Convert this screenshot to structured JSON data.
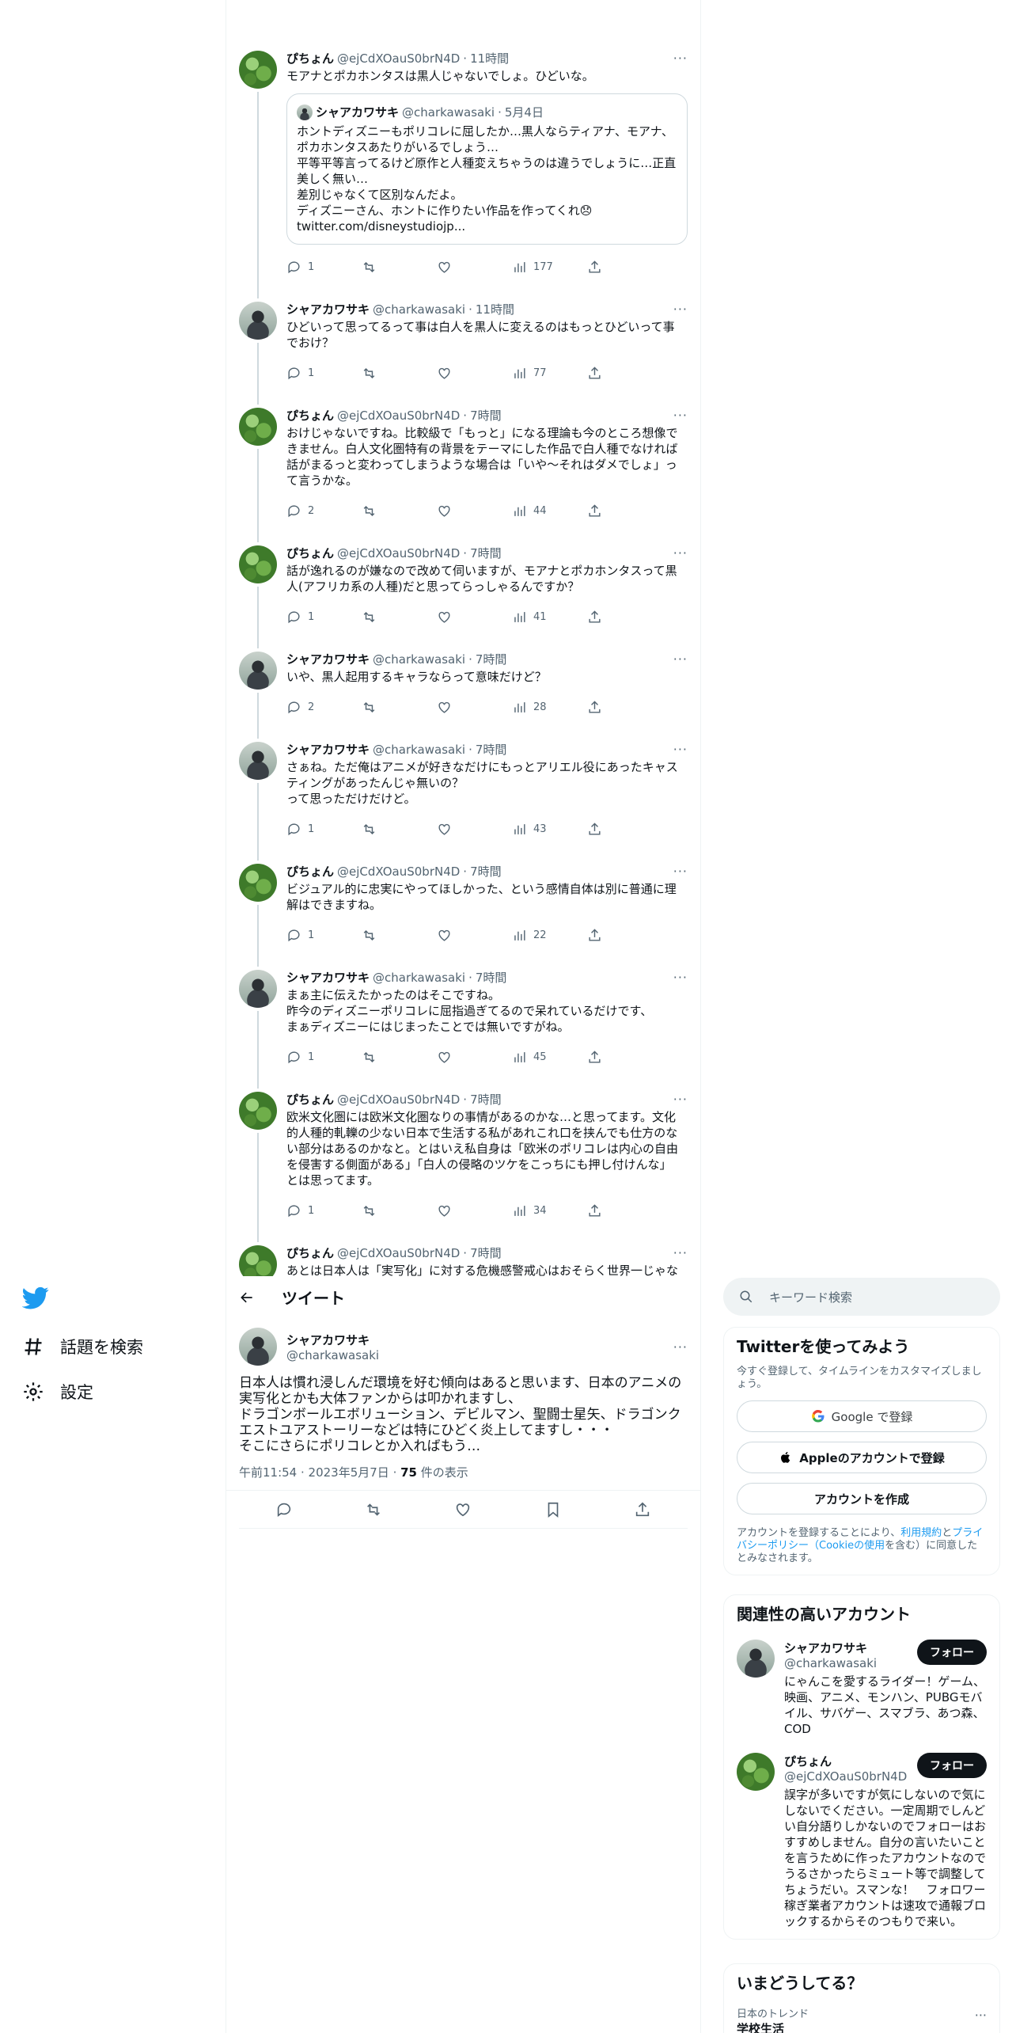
{
  "nav": {
    "explore_label": "話題を検索",
    "settings_label": "設定"
  },
  "thread": [
    {
      "name": "ぴちょん",
      "handle": "@ejCdXOauS0brN4D",
      "time": "11時間",
      "avatar": "g",
      "text": "モアナとポカホンタスは黒人じゃないでしょ。ひどいな。",
      "quote": {
        "name": "シャアカワサキ",
        "handle": "@charkawasaki",
        "time": "5月4日",
        "text": "ホントディズニーもポリコレに屈したか…黒人ならティアナ、モアナ、\nポカホンタスあたりがいるでしょう…\n平等平等言ってるけど原作と人種変えちゃうのは違うでしょうに…正直\n美しく無い…\n差別じゃなくて区別なんだよ。\nディズニーさん、ホントに作りたい作品を作ってくれ😞\ntwitter.com/disneystudiojp..."
      },
      "replies": "1",
      "views": "177"
    },
    {
      "name": "シャアカワサキ",
      "handle": "@charkawasaki",
      "time": "11時間",
      "avatar": "k",
      "text": "ひどいって思ってるって事は白人を黒人に変えるのはもっとひどいって事\nでおけ？",
      "replies": "1",
      "views": "77"
    },
    {
      "name": "ぴちょん",
      "handle": "@ejCdXOauS0brN4D",
      "time": "7時間",
      "avatar": "g",
      "text": "おけじゃないですね。比較級で「もっと」になる理論も今のところ想像で\nきません。白人文化圏特有の背景をテーマにした作品で白人種でなければ\n話がまるっと変わってしまうような場合は「いや〜それはダメでしょ」っ\nて言うかな。",
      "replies": "2",
      "views": "44"
    },
    {
      "name": "ぴちょん",
      "handle": "@ejCdXOauS0brN4D",
      "time": "7時間",
      "avatar": "g",
      "text": "話が逸れるのが嫌なので改めて伺いますが、モアナとポカホンタスって黒\n人(アフリカ系の人種)だと思ってらっしゃるんですか？",
      "replies": "1",
      "views": "41"
    },
    {
      "name": "シャアカワサキ",
      "handle": "@charkawasaki",
      "time": "7時間",
      "avatar": "k",
      "text": "いや、黒人起用するキャラならって意味だけど？",
      "replies": "2",
      "views": "28"
    },
    {
      "name": "シャアカワサキ",
      "handle": "@charkawasaki",
      "time": "7時間",
      "avatar": "k",
      "text": "さぁね。ただ俺はアニメが好きなだけにもっとアリエル役にあったキャス\nティングがあったんじゃ無いの？\nって思っただけだけど。",
      "replies": "1",
      "views": "43"
    },
    {
      "name": "ぴちょん",
      "handle": "@ejCdXOauS0brN4D",
      "time": "7時間",
      "avatar": "g",
      "text": "ビジュアル的に忠実にやってほしかった、という感情自体は別に普通に理\n解はできますね。",
      "replies": "1",
      "views": "22"
    },
    {
      "name": "シャアカワサキ",
      "handle": "@charkawasaki",
      "time": "7時間",
      "avatar": "k",
      "text": "まぁ主に伝えたかったのはそこですね。\n昨今のディズニーポリコレに屈指過ぎてるので呆れているだけです、\nまぁディズニーにはじまったことでは無いですがね。",
      "replies": "1",
      "views": "45"
    },
    {
      "name": "ぴちょん",
      "handle": "@ejCdXOauS0brN4D",
      "time": "7時間",
      "avatar": "g",
      "text": "欧米文化圏には欧米文化圏なりの事情があるのかな…と思ってます。文化\n的人種的軋轢の少ない日本で生活する私があれこれ口を挟んでも仕方のな\nい部分はあるのかなと。とはいえ私自身は「欧米のポリコレは内心の自由\nを侵害する側面がある」「白人の侵略のツケをこっちにも押し付けんな」\nとは思ってます。",
      "replies": "1",
      "views": "34"
    },
    {
      "name": "ぴちょん",
      "handle": "@ejCdXOauS0brN4D",
      "time": "7時間",
      "avatar": "g",
      "text": "あとは日本人は「実写化」に対する危機感警戒心はおそらく世界一じゃな\nいかなと思いますので、「ポリコレ」の持つ暴力性に対する反発と「実写\n化」に対する警戒心が合体して不満が膨れ上がってる状況に見えますね。",
      "replies": "",
      "views": ""
    }
  ],
  "detail": {
    "header": "ツイート",
    "name": "シャアカワサキ",
    "handle": "@charkawasaki",
    "text": "日本人は慣れ浸しんだ環境を好む傾向はあると思います、日本のアニメの\n実写化とかも大体ファンからは叩かれますし、\nドラゴンボールエボリューション、デビルマン、聖闘士星矢、ドラゴンク\nエストユアストーリーなどは特にひどく炎上してますし・・・\nそこにさらにポリコレとか入ればもう…",
    "time": "午前11:54",
    "date": "2023年5月7日",
    "views": "75",
    "views_suffix": "件の表示"
  },
  "sidebar": {
    "search_placeholder": "キーワード検索",
    "signup": {
      "title": "Twitterを使ってみよう",
      "subtitle": "今すぐ登録して、タイムラインをカスタマイズしましょう。",
      "google": "Google で登録",
      "apple": "Appleのアカウントで登録",
      "create": "アカウントを作成",
      "terms_pre": "アカウントを登録することにより、",
      "terms_link": "利用規約",
      "terms_mid": "と",
      "privacy_link": "プライバシーポリシー",
      "cookie_link": "（Cookieの使用",
      "terms_post": "を含む）に同意したとみなされます。"
    },
    "related": {
      "title": "関連性の高いアカウント",
      "follow": "フォロー",
      "accounts": [
        {
          "name": "シャアカワサキ",
          "handle": "@charkawasaki",
          "bio": "にゃんこを愛するライダー！ゲーム、映画、アニメ、モンハン、PUBGモバイル、サバゲー、スマブラ、あつ森、COD"
        },
        {
          "name": "ぴちょん",
          "handle": "@ejCdXOauS0brN4D",
          "bio": "誤字が多いですが気にしないので気にしないでください。一定周期でしんどい自分語りしかないのでフォローはおすすめしません。自分の言いたいことを言うために作ったアカウントなのでうるさかったらミュート等で調整してちょうだい。スマンな！　フォロワー稼ぎ業者アカウントは速攻で通報ブロックするからそのつもりで来い。"
        }
      ]
    },
    "trends": {
      "title": "いまどうしてる？",
      "label": "日本のトレンド",
      "item": "学校生活"
    }
  }
}
